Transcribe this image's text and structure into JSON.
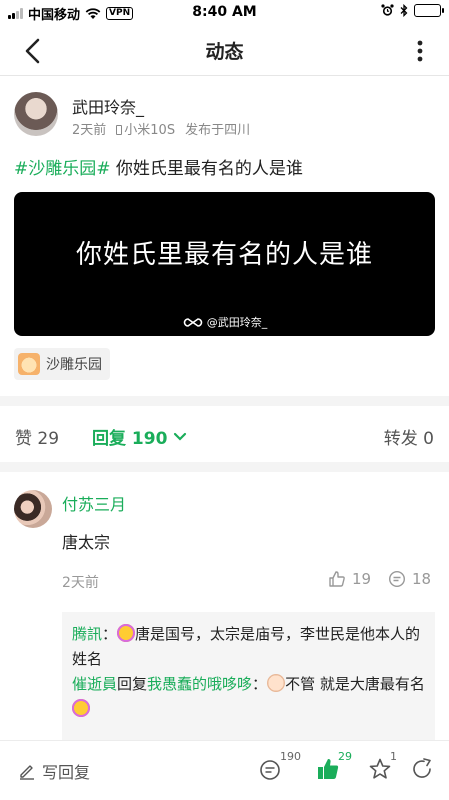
{
  "status_bar": {
    "carrier": "中国移动",
    "vpn": "VPN",
    "time": "8:40 AM"
  },
  "nav": {
    "title": "动态"
  },
  "post": {
    "author_name": "武田玲奈_",
    "time_ago": "2天前",
    "device": "小米10S",
    "location": "发布于四川",
    "topic_tag": "#沙雕乐园#",
    "text": "你姓氏里最有名的人是谁",
    "image_caption": "你姓氏里最有名的人是谁",
    "image_watermark": "@武田玲奈_",
    "topic_chip": "沙雕乐园"
  },
  "actions": {
    "likes": "赞 29",
    "replies": "回复 190",
    "shares": "转发 0"
  },
  "comment": {
    "author": "付苏三月",
    "text": "唐太宗",
    "time_ago": "2天前",
    "like_count": "19",
    "reply_count": "18",
    "sub_replies": [
      {
        "name": "腾訊",
        "sep": "：",
        "text": "唐是国号，太宗是庙号，李世民是他本人的姓名"
      },
      {
        "name": "催逝員",
        "reply_word": "回复",
        "target": "我愚蠢的哦哆哆",
        "sep": "：",
        "text": "不管 就是大唐最有名"
      }
    ]
  },
  "bottom_bar": {
    "write_reply": "写回复",
    "comment_count": "190",
    "like_count": "29",
    "star_count": "1"
  },
  "colors": {
    "accent": "#1aad5a",
    "muted": "#999999",
    "divider": "#f4f4f4"
  }
}
